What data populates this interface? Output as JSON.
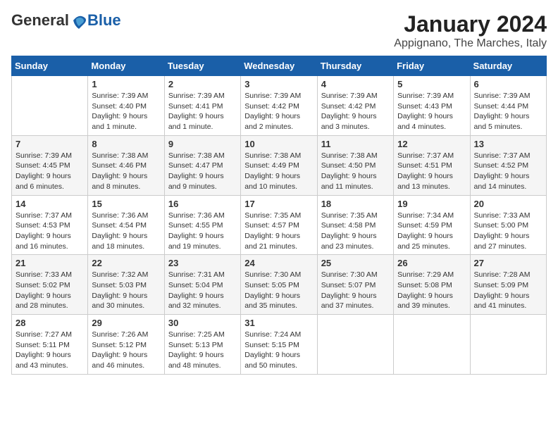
{
  "logo": {
    "general": "General",
    "blue": "Blue"
  },
  "title": "January 2024",
  "subtitle": "Appignano, The Marches, Italy",
  "days": [
    "Sunday",
    "Monday",
    "Tuesday",
    "Wednesday",
    "Thursday",
    "Friday",
    "Saturday"
  ],
  "weeks": [
    [
      {
        "day": "",
        "info": ""
      },
      {
        "day": "1",
        "info": "Sunrise: 7:39 AM\nSunset: 4:40 PM\nDaylight: 9 hours\nand 1 minute."
      },
      {
        "day": "2",
        "info": "Sunrise: 7:39 AM\nSunset: 4:41 PM\nDaylight: 9 hours\nand 1 minute."
      },
      {
        "day": "3",
        "info": "Sunrise: 7:39 AM\nSunset: 4:42 PM\nDaylight: 9 hours\nand 2 minutes."
      },
      {
        "day": "4",
        "info": "Sunrise: 7:39 AM\nSunset: 4:42 PM\nDaylight: 9 hours\nand 3 minutes."
      },
      {
        "day": "5",
        "info": "Sunrise: 7:39 AM\nSunset: 4:43 PM\nDaylight: 9 hours\nand 4 minutes."
      },
      {
        "day": "6",
        "info": "Sunrise: 7:39 AM\nSunset: 4:44 PM\nDaylight: 9 hours\nand 5 minutes."
      }
    ],
    [
      {
        "day": "7",
        "info": "Sunrise: 7:39 AM\nSunset: 4:45 PM\nDaylight: 9 hours\nand 6 minutes."
      },
      {
        "day": "8",
        "info": "Sunrise: 7:38 AM\nSunset: 4:46 PM\nDaylight: 9 hours\nand 8 minutes."
      },
      {
        "day": "9",
        "info": "Sunrise: 7:38 AM\nSunset: 4:47 PM\nDaylight: 9 hours\nand 9 minutes."
      },
      {
        "day": "10",
        "info": "Sunrise: 7:38 AM\nSunset: 4:49 PM\nDaylight: 9 hours\nand 10 minutes."
      },
      {
        "day": "11",
        "info": "Sunrise: 7:38 AM\nSunset: 4:50 PM\nDaylight: 9 hours\nand 11 minutes."
      },
      {
        "day": "12",
        "info": "Sunrise: 7:37 AM\nSunset: 4:51 PM\nDaylight: 9 hours\nand 13 minutes."
      },
      {
        "day": "13",
        "info": "Sunrise: 7:37 AM\nSunset: 4:52 PM\nDaylight: 9 hours\nand 14 minutes."
      }
    ],
    [
      {
        "day": "14",
        "info": "Sunrise: 7:37 AM\nSunset: 4:53 PM\nDaylight: 9 hours\nand 16 minutes."
      },
      {
        "day": "15",
        "info": "Sunrise: 7:36 AM\nSunset: 4:54 PM\nDaylight: 9 hours\nand 18 minutes."
      },
      {
        "day": "16",
        "info": "Sunrise: 7:36 AM\nSunset: 4:55 PM\nDaylight: 9 hours\nand 19 minutes."
      },
      {
        "day": "17",
        "info": "Sunrise: 7:35 AM\nSunset: 4:57 PM\nDaylight: 9 hours\nand 21 minutes."
      },
      {
        "day": "18",
        "info": "Sunrise: 7:35 AM\nSunset: 4:58 PM\nDaylight: 9 hours\nand 23 minutes."
      },
      {
        "day": "19",
        "info": "Sunrise: 7:34 AM\nSunset: 4:59 PM\nDaylight: 9 hours\nand 25 minutes."
      },
      {
        "day": "20",
        "info": "Sunrise: 7:33 AM\nSunset: 5:00 PM\nDaylight: 9 hours\nand 27 minutes."
      }
    ],
    [
      {
        "day": "21",
        "info": "Sunrise: 7:33 AM\nSunset: 5:02 PM\nDaylight: 9 hours\nand 28 minutes."
      },
      {
        "day": "22",
        "info": "Sunrise: 7:32 AM\nSunset: 5:03 PM\nDaylight: 9 hours\nand 30 minutes."
      },
      {
        "day": "23",
        "info": "Sunrise: 7:31 AM\nSunset: 5:04 PM\nDaylight: 9 hours\nand 32 minutes."
      },
      {
        "day": "24",
        "info": "Sunrise: 7:30 AM\nSunset: 5:05 PM\nDaylight: 9 hours\nand 35 minutes."
      },
      {
        "day": "25",
        "info": "Sunrise: 7:30 AM\nSunset: 5:07 PM\nDaylight: 9 hours\nand 37 minutes."
      },
      {
        "day": "26",
        "info": "Sunrise: 7:29 AM\nSunset: 5:08 PM\nDaylight: 9 hours\nand 39 minutes."
      },
      {
        "day": "27",
        "info": "Sunrise: 7:28 AM\nSunset: 5:09 PM\nDaylight: 9 hours\nand 41 minutes."
      }
    ],
    [
      {
        "day": "28",
        "info": "Sunrise: 7:27 AM\nSunset: 5:11 PM\nDaylight: 9 hours\nand 43 minutes."
      },
      {
        "day": "29",
        "info": "Sunrise: 7:26 AM\nSunset: 5:12 PM\nDaylight: 9 hours\nand 46 minutes."
      },
      {
        "day": "30",
        "info": "Sunrise: 7:25 AM\nSunset: 5:13 PM\nDaylight: 9 hours\nand 48 minutes."
      },
      {
        "day": "31",
        "info": "Sunrise: 7:24 AM\nSunset: 5:15 PM\nDaylight: 9 hours\nand 50 minutes."
      },
      {
        "day": "",
        "info": ""
      },
      {
        "day": "",
        "info": ""
      },
      {
        "day": "",
        "info": ""
      }
    ]
  ]
}
